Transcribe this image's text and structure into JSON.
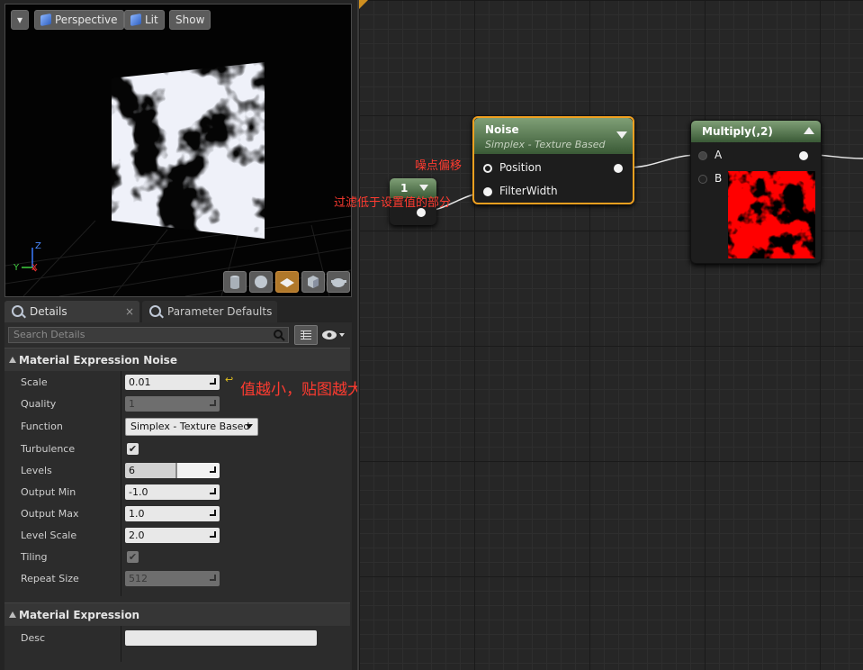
{
  "viewport": {
    "menu_label": "▾",
    "perspective_label": "Perspective",
    "lit_label": "Lit",
    "show_label": "Show",
    "axis_x": "X",
    "axis_y": "Y",
    "axis_z": "Z",
    "preview_icons": [
      "cylinder-icon",
      "sphere-icon",
      "plane-icon",
      "cube-icon",
      "teapot-icon"
    ]
  },
  "tabs": [
    {
      "label": "Details",
      "close": "×"
    },
    {
      "label": "Parameter Defaults",
      "close": "×"
    }
  ],
  "details": {
    "search_placeholder": "Search Details",
    "section1_title": "Material Expression Noise",
    "section2_title": "Material Expression",
    "properties": [
      {
        "label": "Scale",
        "value": "0.01"
      },
      {
        "label": "Quality",
        "value": "1"
      },
      {
        "label": "Function",
        "value": "Simplex - Texture Based"
      },
      {
        "label": "Turbulence",
        "value": "✔"
      },
      {
        "label": "Levels",
        "value": "6"
      },
      {
        "label": "Output Min",
        "value": "-1.0"
      },
      {
        "label": "Output Max",
        "value": "1.0"
      },
      {
        "label": "Level Scale",
        "value": "2.0"
      },
      {
        "label": "Tiling",
        "value": "✔"
      },
      {
        "label": "Repeat Size",
        "value": "512"
      }
    ],
    "desc_label": "Desc",
    "desc_value": "",
    "reset_arrow": "↩"
  },
  "annotations": {
    "scale_note": "值越小，贴图越大",
    "position_note": "噪点偏移",
    "filter_note": "过滤低于设置值的部分"
  },
  "graph": {
    "const_node": {
      "value": "1"
    },
    "noise_node": {
      "title": "Noise",
      "subtitle": "Simplex - Texture Based",
      "pin1": "Position",
      "pin2": "FilterWidth"
    },
    "multiply_node": {
      "title": "Multiply(,2)",
      "pin_a": "A",
      "pin_b": "B"
    }
  },
  "colors": {
    "accent_orange": "#f0a020",
    "node_header_green": "#6f8f66",
    "annotation_red": "#ff3b30"
  }
}
